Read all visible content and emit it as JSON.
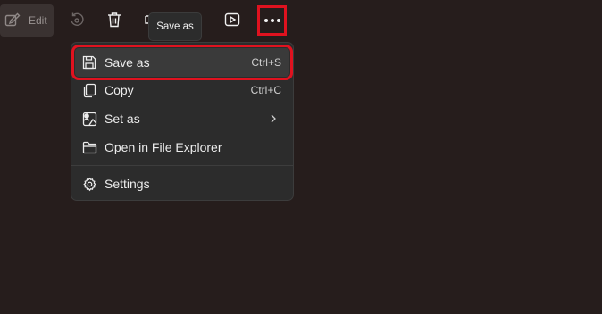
{
  "toolbar": {
    "edit_label": "Edit",
    "buttons": [
      "edit-icon",
      "rotate-icon",
      "delete-icon",
      "slideshow-icon",
      "more-icon"
    ]
  },
  "tooltip": {
    "text": "Save as"
  },
  "menu": {
    "items": [
      {
        "label": "Save as",
        "shortcut": "Ctrl+S",
        "icon": "save-icon"
      },
      {
        "label": "Copy",
        "shortcut": "Ctrl+C",
        "icon": "copy-icon"
      },
      {
        "label": "Set as",
        "icon": "image-person-icon",
        "submenu_icon": "chevron-right-icon"
      },
      {
        "label": "Open in File Explorer",
        "icon": "folder-icon"
      },
      {
        "label": "Settings",
        "icon": "gear-icon"
      }
    ]
  },
  "colors": {
    "background": "#261d1c",
    "menu_background": "#2c2c2c",
    "highlight": "#e0121f"
  }
}
